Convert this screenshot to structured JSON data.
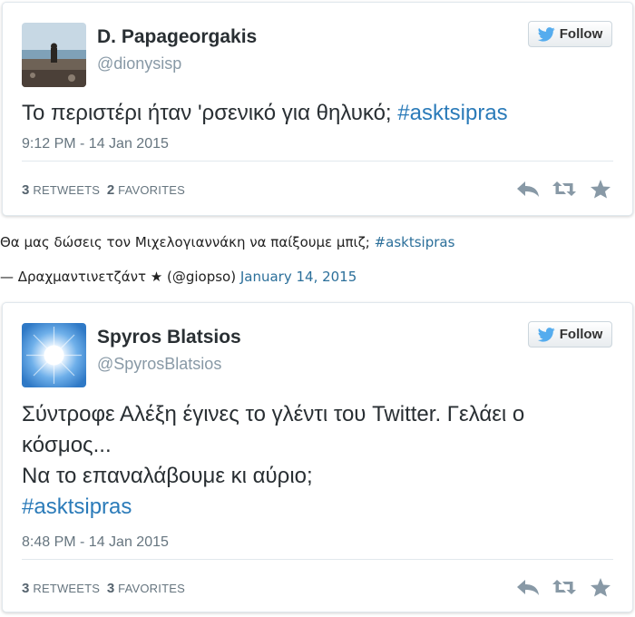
{
  "tweet1": {
    "display_name": "D. Papageorgakis",
    "screen_name": "@dionysisp",
    "follow_label": "Follow",
    "text": "Το περιστέρι ήταν 'ρσενικό για θηλυκό; ",
    "hashtag": "#asktsipras",
    "timestamp": "9:12 PM - 14 Jan 2015",
    "retweets_count": "3",
    "retweets_label": "RETWEETS",
    "favorites_count": "2",
    "favorites_label": "FAVORITES",
    "icons": [
      "reply-icon",
      "retweet-icon",
      "favorite-icon"
    ]
  },
  "embed_fallback": {
    "text": "Θα μας δώσεις τον Μιχελογιαννάκη να παίξουμε μπιζ; ",
    "hashtag": "#asktsipras",
    "author_line": "— Δραχμαντινετζάντ ★ (@giopso) ",
    "date_link": "January 14, 2015"
  },
  "tweet2": {
    "display_name": "Spyros Blatsios",
    "screen_name": "@SpyrosBlatsios",
    "follow_label": "Follow",
    "text_line1": "Σύντροφε Αλέξη έγινες το γλέντι του Twitter. Γελάει ο",
    "text_line2": "κόσμος...",
    "text_line3": "Να το επαναλάβουμε κι αύριο;",
    "hashtag": "#asktsipras",
    "timestamp": "8:48 PM - 14 Jan 2015",
    "retweets_count": "3",
    "retweets_label": "RETWEETS",
    "favorites_count": "3",
    "favorites_label": "FAVORITES",
    "icons": [
      "reply-icon",
      "retweet-icon",
      "favorite-icon"
    ]
  },
  "colors": {
    "hashtag": "#2b7bb9",
    "twitter_bird": "#55acee",
    "muted": "#8899a6",
    "action_icons": "#8899a6"
  }
}
